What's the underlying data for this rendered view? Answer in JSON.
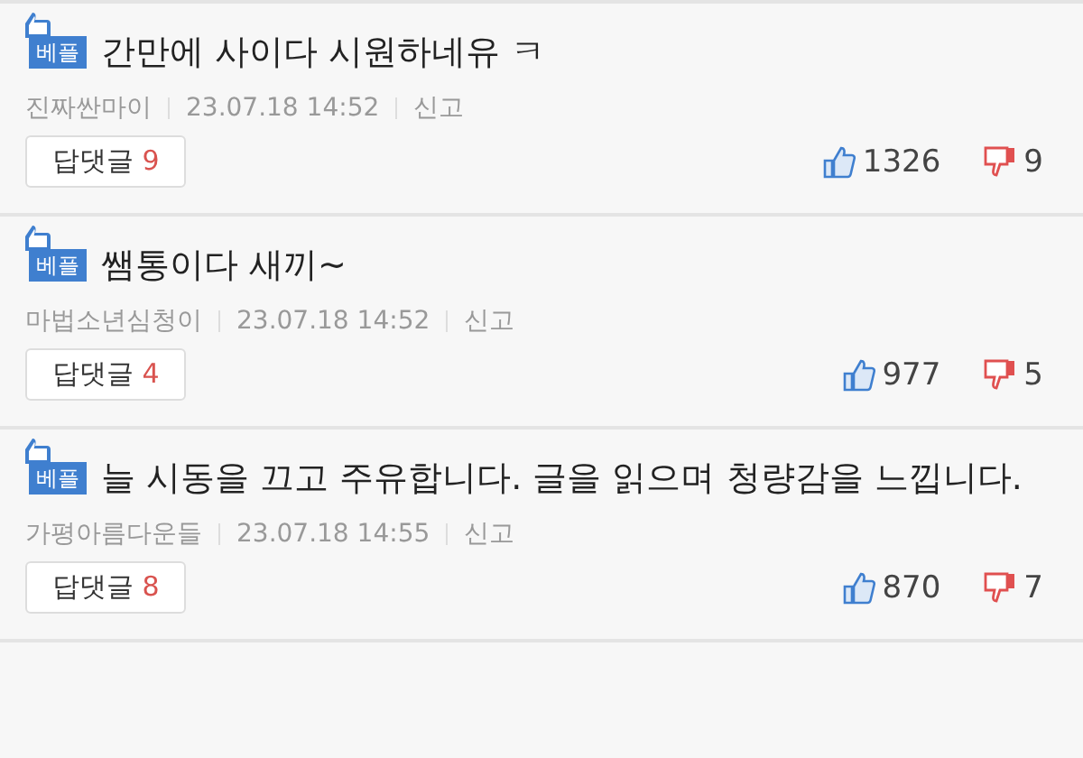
{
  "comments": [
    {
      "badge": "베플",
      "text": "간만에 사이다 시원하네유 ㅋ",
      "author": "진짜싼마이",
      "time": "23.07.18  14:52",
      "report": "신고",
      "reply_label": "답댓글",
      "reply_count": "9",
      "likes": "1326",
      "dislikes": "9"
    },
    {
      "badge": "베플",
      "text": "쌤통이다 새끼~",
      "author": "마법소년심청이",
      "time": "23.07.18  14:52",
      "report": "신고",
      "reply_label": "답댓글",
      "reply_count": "4",
      "likes": "977",
      "dislikes": "5"
    },
    {
      "badge": "베플",
      "text": "늘 시동을 끄고 주유합니다. 글을 읽으며 청량감을 느낍니다.",
      "author": "가평아름다운들",
      "time": "23.07.18  14:55",
      "report": "신고",
      "reply_label": "답댓글",
      "reply_count": "8",
      "likes": "870",
      "dislikes": "7"
    }
  ]
}
